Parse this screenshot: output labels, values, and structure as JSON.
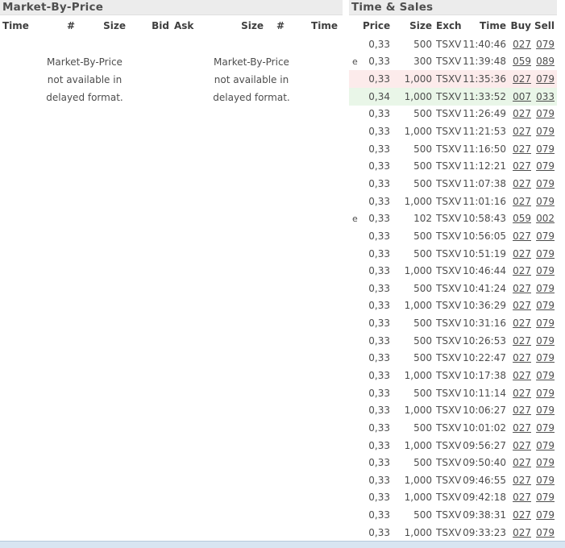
{
  "market_by_price": {
    "title": "Market-By-Price",
    "columns": [
      "Time",
      "#",
      "Size",
      "Bid",
      "Ask",
      "Size",
      "#",
      "Time"
    ],
    "bid_message": [
      "Market-By-Price",
      "not available in",
      "delayed format."
    ],
    "ask_message": [
      "Market-By-Price",
      "not available in",
      "delayed format."
    ]
  },
  "time_and_sales": {
    "title": "Time & Sales",
    "columns": [
      "Price",
      "Size",
      "Exch",
      "Time",
      "Buy",
      "Sell"
    ],
    "colors": {
      "highlight_downtick": "#fcebeb",
      "highlight_uptick": "#e9f6e8"
    },
    "rows": [
      {
        "marker": "",
        "price": "0,33",
        "size": "500",
        "exch": "TSXV",
        "time": "11:40:46",
        "buy": "027",
        "sell": "079",
        "tick": ""
      },
      {
        "marker": "e",
        "price": "0,33",
        "size": "300",
        "exch": "TSXV",
        "time": "11:39:48",
        "buy": "059",
        "sell": "089",
        "tick": ""
      },
      {
        "marker": "",
        "price": "0,33",
        "size": "1,000",
        "exch": "TSXV",
        "time": "11:35:36",
        "buy": "027",
        "sell": "079",
        "tick": "down"
      },
      {
        "marker": "",
        "price": "0,34",
        "size": "1,000",
        "exch": "TSXV",
        "time": "11:33:52",
        "buy": "007",
        "sell": "033",
        "tick": "up"
      },
      {
        "marker": "",
        "price": "0,33",
        "size": "500",
        "exch": "TSXV",
        "time": "11:26:49",
        "buy": "027",
        "sell": "079",
        "tick": ""
      },
      {
        "marker": "",
        "price": "0,33",
        "size": "1,000",
        "exch": "TSXV",
        "time": "11:21:53",
        "buy": "027",
        "sell": "079",
        "tick": ""
      },
      {
        "marker": "",
        "price": "0,33",
        "size": "500",
        "exch": "TSXV",
        "time": "11:16:50",
        "buy": "027",
        "sell": "079",
        "tick": ""
      },
      {
        "marker": "",
        "price": "0,33",
        "size": "500",
        "exch": "TSXV",
        "time": "11:12:21",
        "buy": "027",
        "sell": "079",
        "tick": ""
      },
      {
        "marker": "",
        "price": "0,33",
        "size": "500",
        "exch": "TSXV",
        "time": "11:07:38",
        "buy": "027",
        "sell": "079",
        "tick": ""
      },
      {
        "marker": "",
        "price": "0,33",
        "size": "1,000",
        "exch": "TSXV",
        "time": "11:01:16",
        "buy": "027",
        "sell": "079",
        "tick": ""
      },
      {
        "marker": "e",
        "price": "0,33",
        "size": "102",
        "exch": "TSXV",
        "time": "10:58:43",
        "buy": "059",
        "sell": "002",
        "tick": ""
      },
      {
        "marker": "",
        "price": "0,33",
        "size": "500",
        "exch": "TSXV",
        "time": "10:56:05",
        "buy": "027",
        "sell": "079",
        "tick": ""
      },
      {
        "marker": "",
        "price": "0,33",
        "size": "500",
        "exch": "TSXV",
        "time": "10:51:19",
        "buy": "027",
        "sell": "079",
        "tick": ""
      },
      {
        "marker": "",
        "price": "0,33",
        "size": "1,000",
        "exch": "TSXV",
        "time": "10:46:44",
        "buy": "027",
        "sell": "079",
        "tick": ""
      },
      {
        "marker": "",
        "price": "0,33",
        "size": "500",
        "exch": "TSXV",
        "time": "10:41:24",
        "buy": "027",
        "sell": "079",
        "tick": ""
      },
      {
        "marker": "",
        "price": "0,33",
        "size": "1,000",
        "exch": "TSXV",
        "time": "10:36:29",
        "buy": "027",
        "sell": "079",
        "tick": ""
      },
      {
        "marker": "",
        "price": "0,33",
        "size": "500",
        "exch": "TSXV",
        "time": "10:31:16",
        "buy": "027",
        "sell": "079",
        "tick": ""
      },
      {
        "marker": "",
        "price": "0,33",
        "size": "500",
        "exch": "TSXV",
        "time": "10:26:53",
        "buy": "027",
        "sell": "079",
        "tick": ""
      },
      {
        "marker": "",
        "price": "0,33",
        "size": "500",
        "exch": "TSXV",
        "time": "10:22:47",
        "buy": "027",
        "sell": "079",
        "tick": ""
      },
      {
        "marker": "",
        "price": "0,33",
        "size": "1,000",
        "exch": "TSXV",
        "time": "10:17:38",
        "buy": "027",
        "sell": "079",
        "tick": ""
      },
      {
        "marker": "",
        "price": "0,33",
        "size": "500",
        "exch": "TSXV",
        "time": "10:11:14",
        "buy": "027",
        "sell": "079",
        "tick": ""
      },
      {
        "marker": "",
        "price": "0,33",
        "size": "1,000",
        "exch": "TSXV",
        "time": "10:06:27",
        "buy": "027",
        "sell": "079",
        "tick": ""
      },
      {
        "marker": "",
        "price": "0,33",
        "size": "500",
        "exch": "TSXV",
        "time": "10:01:02",
        "buy": "027",
        "sell": "079",
        "tick": ""
      },
      {
        "marker": "",
        "price": "0,33",
        "size": "1,000",
        "exch": "TSXV",
        "time": "09:56:27",
        "buy": "027",
        "sell": "079",
        "tick": ""
      },
      {
        "marker": "",
        "price": "0,33",
        "size": "500",
        "exch": "TSXV",
        "time": "09:50:40",
        "buy": "027",
        "sell": "079",
        "tick": ""
      },
      {
        "marker": "",
        "price": "0,33",
        "size": "1,000",
        "exch": "TSXV",
        "time": "09:46:55",
        "buy": "027",
        "sell": "079",
        "tick": ""
      },
      {
        "marker": "",
        "price": "0,33",
        "size": "1,000",
        "exch": "TSXV",
        "time": "09:42:18",
        "buy": "027",
        "sell": "079",
        "tick": ""
      },
      {
        "marker": "",
        "price": "0,33",
        "size": "500",
        "exch": "TSXV",
        "time": "09:38:31",
        "buy": "027",
        "sell": "079",
        "tick": ""
      },
      {
        "marker": "",
        "price": "0,33",
        "size": "1,000",
        "exch": "TSXV",
        "time": "09:33:23",
        "buy": "027",
        "sell": "079",
        "tick": ""
      }
    ]
  }
}
